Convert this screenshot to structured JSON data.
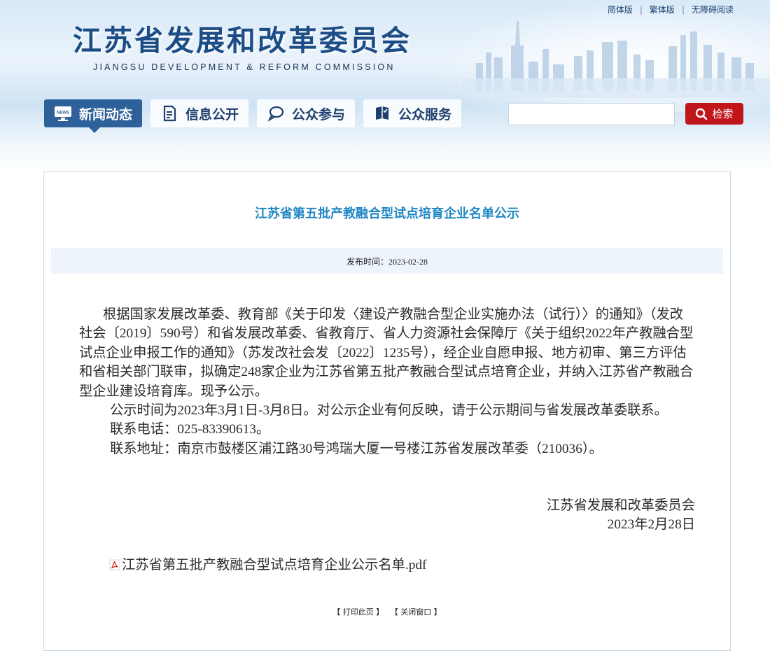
{
  "top_links": [
    "简体版",
    "繁体版",
    "无障碍阅读"
  ],
  "site": {
    "title": "江苏省发展和改革委员会",
    "subtitle": "JIANGSU DEVELOPMENT & REFORM COMMISSION"
  },
  "nav": [
    {
      "label": "新闻动态",
      "icon": "news-icon",
      "active": true
    },
    {
      "label": "信息公开",
      "icon": "document-icon",
      "active": false
    },
    {
      "label": "公众参与",
      "icon": "chat-icon",
      "active": false
    },
    {
      "label": "公众服务",
      "icon": "book-icon",
      "active": false
    }
  ],
  "search": {
    "value": "",
    "button_label": "检索"
  },
  "article": {
    "title": "江苏省第五批产教融合型试点培育企业名单公示",
    "publish_time": "发布时间：2023-02-28",
    "paragraphs": [
      "根据国家发展改革委、教育部《关于印发〈建设产教融合型企业实施办法（试行）〉的通知》（发改社会〔2019〕590号）和省发展改革委、省教育厅、省人力资源社会保障厅《关于组织2022年产教融合型试点企业申报工作的通知》（苏发改社会发〔2022〕1235号），经企业自愿申报、地方初审、第三方评估和省相关部门联审，拟确定248家企业为江苏省第五批产教融合型试点培育企业，并纳入江苏省产教融合型企业建设培育库。现予公示。",
      "公示时间为2023年3月1日-3月8日。对公示企业有何反映，请于公示期间与省发展改革委联系。",
      "联系电话：025-83390613。",
      "联系地址：南京市鼓楼区浦江路30号鸿瑞大厦一号楼江苏省发展改革委（210036）。"
    ],
    "signature_org": "江苏省发展和改革委员会",
    "signature_date": "2023年2月28日",
    "attachment": "江苏省第五批产教融合型试点培育企业公示名单.pdf"
  },
  "footer": {
    "print": "【 打印此页 】",
    "close": "【 关闭窗口 】"
  },
  "colors": {
    "nav_active": "#2e6199",
    "title": "#1f86c4",
    "search_button": "#c0161b"
  }
}
